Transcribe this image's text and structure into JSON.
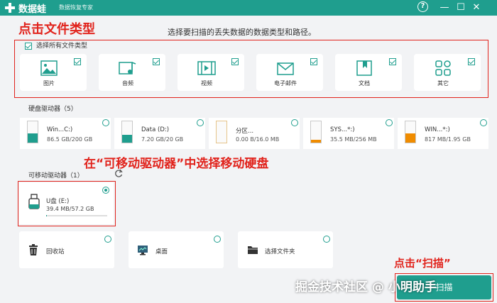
{
  "titlebar": {
    "app_name": "数据蛙",
    "app_subtitle": "数据恢复专家",
    "help_icon": "help-icon",
    "min_icon": "minimize-icon",
    "max_icon": "maximize-icon",
    "close_icon": "close-icon"
  },
  "instruction": "选择要扫描的丢失数据的数据类型和路径。",
  "annotations": {
    "step1": "点击文件类型",
    "step2": "在“可移动驱动器”中选择移动硬盘",
    "step3": "点击“扫描”"
  },
  "file_types": {
    "select_all_label": "选择所有文件类型",
    "select_all_checked": true,
    "items": [
      {
        "label": "图片",
        "icon": "image-icon",
        "checked": true
      },
      {
        "label": "音频",
        "icon": "audio-icon",
        "checked": true
      },
      {
        "label": "视频",
        "icon": "video-icon",
        "checked": true
      },
      {
        "label": "电子邮件",
        "icon": "email-icon",
        "checked": true
      },
      {
        "label": "文档",
        "icon": "document-icon",
        "checked": true
      },
      {
        "label": "其它",
        "icon": "other-icon",
        "checked": true
      }
    ]
  },
  "hard_drives": {
    "label": "硬盘驱动器（5）",
    "items": [
      {
        "name": "Win...C:)",
        "size": "86.5 GB/200 GB",
        "fill": 0.43,
        "color": "#1f9e8e"
      },
      {
        "name": "Data (D:)",
        "size": "7.20 GB/20 GB",
        "fill": 0.36,
        "color": "#1f9e8e"
      },
      {
        "name": "分区...",
        "size": "0.00  B/16.0 MB",
        "fill": 0.0,
        "color": "#1f9e8e"
      },
      {
        "name": "SYS...*:)",
        "size": "35.5 MB/256 MB",
        "fill": 0.14,
        "color": "#f08c00"
      },
      {
        "name": "WIN...*:)",
        "size": "817 MB/1.95 GB",
        "fill": 0.42,
        "color": "#f08c00"
      }
    ]
  },
  "removable": {
    "label": "可移动驱动器（1）",
    "refresh_icon": "refresh-icon",
    "drive": {
      "name": "U盘 (E:)",
      "size": "39.4 MB/57.2 GB",
      "fill": 0.001,
      "selected": true
    }
  },
  "locations": [
    {
      "label": "回收站",
      "icon": "recycle-bin-icon"
    },
    {
      "label": "桌面",
      "icon": "desktop-icon"
    },
    {
      "label": "选择文件夹",
      "icon": "folder-icon"
    }
  ],
  "scan_button": "扫描",
  "watermark": "掘金技术社区 @ 小明助手",
  "colors": {
    "accent": "#1f9e8e",
    "annotation": "#e1231c",
    "warning": "#f08c00"
  }
}
